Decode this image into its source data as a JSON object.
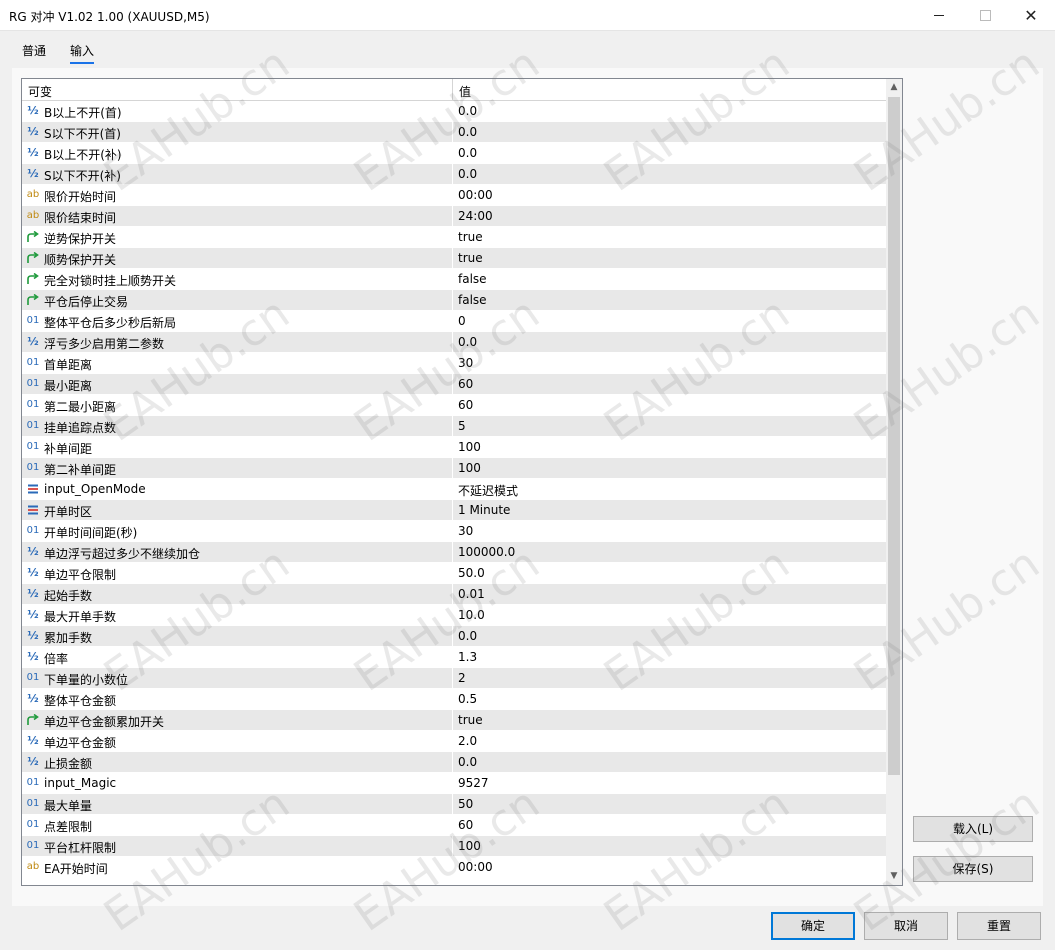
{
  "window": {
    "title": "RG 对冲 V1.02 1.00 (XAUUSD,M5)",
    "minimize_glyph": "—",
    "maximize_glyph": "☐",
    "close_glyph": "✕"
  },
  "tabs": [
    {
      "label": "普通",
      "active": false
    },
    {
      "label": "输入",
      "active": true
    }
  ],
  "grid": {
    "columns": [
      "可变",
      "值"
    ],
    "rows": [
      {
        "icon": "double-icon",
        "name": "B以上不开(首)",
        "value": "0.0"
      },
      {
        "icon": "double-icon",
        "name": "S以下不开(首)",
        "value": "0.0"
      },
      {
        "icon": "double-icon",
        "name": "B以上不开(补)",
        "value": "0.0"
      },
      {
        "icon": "double-icon",
        "name": "S以下不开(补)",
        "value": "0.0"
      },
      {
        "icon": "string-icon",
        "name": "限价开始时间",
        "value": "00:00"
      },
      {
        "icon": "string-icon",
        "name": "限价结束时间",
        "value": "24:00"
      },
      {
        "icon": "bool-icon",
        "name": "逆势保护开关",
        "value": "true"
      },
      {
        "icon": "bool-icon",
        "name": "顺势保护开关",
        "value": "true"
      },
      {
        "icon": "bool-icon",
        "name": "完全对锁时挂上顺势开关",
        "value": "false"
      },
      {
        "icon": "bool-icon",
        "name": "平仓后停止交易",
        "value": "false"
      },
      {
        "icon": "int-icon",
        "name": "整体平仓后多少秒后新局",
        "value": "0"
      },
      {
        "icon": "double-icon",
        "name": "浮亏多少启用第二参数",
        "value": "0.0"
      },
      {
        "icon": "int-icon",
        "name": "首单距离",
        "value": "30"
      },
      {
        "icon": "int-icon",
        "name": "最小距离",
        "value": "60"
      },
      {
        "icon": "int-icon",
        "name": "第二最小距离",
        "value": "60"
      },
      {
        "icon": "int-icon",
        "name": "挂单追踪点数",
        "value": "5"
      },
      {
        "icon": "int-icon",
        "name": "补单间距",
        "value": "100"
      },
      {
        "icon": "int-icon",
        "name": "第二补单间距",
        "value": "100"
      },
      {
        "icon": "enum-icon",
        "name": "input_OpenMode",
        "value": "不延迟模式"
      },
      {
        "icon": "enum-icon",
        "name": "开单时区",
        "value": "1 Minute"
      },
      {
        "icon": "int-icon",
        "name": "开单时间间距(秒)",
        "value": "30"
      },
      {
        "icon": "double-icon",
        "name": "单边浮亏超过多少不继续加仓",
        "value": "100000.0"
      },
      {
        "icon": "double-icon",
        "name": "单边平仓限制",
        "value": "50.0"
      },
      {
        "icon": "double-icon",
        "name": "起始手数",
        "value": "0.01"
      },
      {
        "icon": "double-icon",
        "name": "最大开单手数",
        "value": "10.0"
      },
      {
        "icon": "double-icon",
        "name": "累加手数",
        "value": "0.0"
      },
      {
        "icon": "double-icon",
        "name": "倍率",
        "value": "1.3"
      },
      {
        "icon": "int-icon",
        "name": "下单量的小数位",
        "value": "2"
      },
      {
        "icon": "double-icon",
        "name": "整体平仓金额",
        "value": "0.5"
      },
      {
        "icon": "bool-icon",
        "name": "单边平仓金额累加开关",
        "value": "true"
      },
      {
        "icon": "double-icon",
        "name": "单边平仓金额",
        "value": "2.0"
      },
      {
        "icon": "double-icon",
        "name": "止损金额",
        "value": "0.0"
      },
      {
        "icon": "int-icon",
        "name": "input_Magic",
        "value": "9527"
      },
      {
        "icon": "int-icon",
        "name": "最大单量",
        "value": "50"
      },
      {
        "icon": "int-icon",
        "name": "点差限制",
        "value": "60"
      },
      {
        "icon": "int-icon",
        "name": "平台杠杆限制",
        "value": "100"
      },
      {
        "icon": "string-icon",
        "name": "EA开始时间",
        "value": "00:00"
      }
    ]
  },
  "icon_glyphs": {
    "double": "½",
    "string": "ab",
    "int": "01"
  },
  "buttons": {
    "load": "载入(L)",
    "save": "保存(S)",
    "ok": "确定",
    "cancel": "取消",
    "reset": "重置"
  },
  "watermark": "EAHub.cn",
  "colors": {
    "accent": "#0078d7",
    "tab_underline": "#1a73e8",
    "row_alt": "#e8e8e8",
    "icon_blue": "#2a6ab8",
    "icon_gold": "#c08a12",
    "icon_green": "#1f9a3c"
  }
}
